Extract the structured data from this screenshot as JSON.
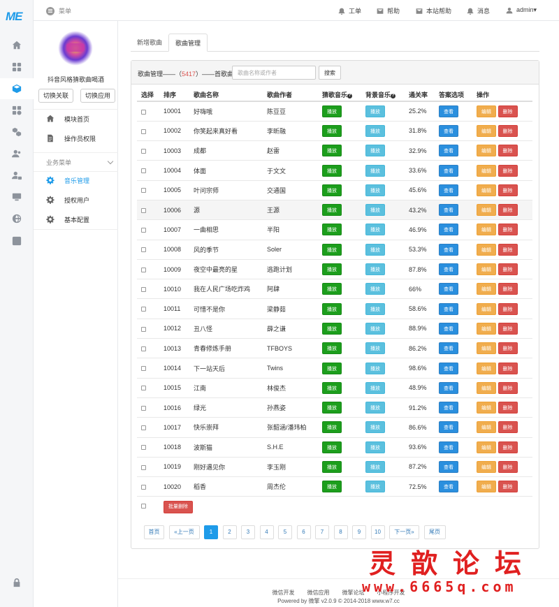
{
  "rail": {
    "logo": "ME",
    "icons": [
      "home-icon",
      "grid-icon",
      "box-icon",
      "apps-icon",
      "cubes-icon",
      "users-icon",
      "user-lock-icon",
      "monitor-icon",
      "globe-icon",
      "store-icon",
      "lock-icon"
    ]
  },
  "topbar": {
    "menu_label": "菜单",
    "items": [
      {
        "label": "工单",
        "icon": "bell-icon"
      },
      {
        "label": "帮助",
        "icon": "mail-icon"
      },
      {
        "label": "本站帮助",
        "icon": "mail-icon"
      },
      {
        "label": "消息",
        "icon": "bell-icon"
      },
      {
        "label": "admin▾",
        "icon": "user-icon"
      }
    ]
  },
  "sidebar": {
    "app_name": "抖音风格猜歌曲喝酒",
    "switch_link": "切换关联",
    "switch_app": "切换应用",
    "items_top": [
      {
        "label": "模块首页",
        "icon": "home-icon"
      },
      {
        "label": "操作员权限",
        "icon": "doc-icon"
      }
    ],
    "group_label": "业务菜单",
    "items_biz": [
      {
        "label": "音乐管理",
        "icon": "gear-icon",
        "active": true
      },
      {
        "label": "授权用户",
        "icon": "gear-icon"
      },
      {
        "label": "基本配置",
        "icon": "gear-icon"
      }
    ]
  },
  "tabs": [
    {
      "label": "新增歌曲",
      "active": false
    },
    {
      "label": "歌曲管理",
      "active": true
    }
  ],
  "panel": {
    "label_prefix": "歌曲管理——（",
    "count": "5417",
    "label_suffix": "）——首歌曲",
    "search_placeholder": "歌曲名称或作者",
    "search_button": "搜索"
  },
  "table": {
    "headers": {
      "select": "选择",
      "order": "排序",
      "name": "歌曲名称",
      "author": "歌曲作者",
      "guess": "猜歌音乐",
      "bg": "背景音乐",
      "rate": "通关率",
      "answer": "答案选项",
      "ops": "操作"
    },
    "buttons": {
      "play": "播放",
      "view": "查看",
      "edit": "编辑",
      "delete": "删除"
    },
    "rows": [
      {
        "id": "10001",
        "name": "好嗨哦",
        "author": "陈豆豆",
        "rate": "25.2%"
      },
      {
        "id": "10002",
        "name": "你笑起来真好看",
        "author": "李昕融",
        "rate": "31.8%"
      },
      {
        "id": "10003",
        "name": "成都",
        "author": "赵雷",
        "rate": "32.9%"
      },
      {
        "id": "10004",
        "name": "体面",
        "author": "于文文",
        "rate": "33.6%"
      },
      {
        "id": "10005",
        "name": "叶问宗师",
        "author": "交通国",
        "rate": "45.6%"
      },
      {
        "id": "10006",
        "name": "源",
        "author": "王源",
        "rate": "43.2%"
      },
      {
        "id": "10007",
        "name": "一曲相思",
        "author": "半阳",
        "rate": "46.9%"
      },
      {
        "id": "10008",
        "name": "风的季节",
        "author": "Soler",
        "rate": "53.3%"
      },
      {
        "id": "10009",
        "name": "夜空中最亮的星",
        "author": "逃跑计划",
        "rate": "87.8%"
      },
      {
        "id": "10010",
        "name": "我在人民广场吃炸鸡",
        "author": "阿肆",
        "rate": "66%"
      },
      {
        "id": "10011",
        "name": "可惜不是你",
        "author": "梁静茹",
        "rate": "58.6%"
      },
      {
        "id": "10012",
        "name": "丑八怪",
        "author": "薛之谦",
        "rate": "88.9%"
      },
      {
        "id": "10013",
        "name": "青春修炼手册",
        "author": "TFBOYS",
        "rate": "86.2%"
      },
      {
        "id": "10014",
        "name": "下一站天后",
        "author": "Twins",
        "rate": "98.6%"
      },
      {
        "id": "10015",
        "name": "江南",
        "author": "林俊杰",
        "rate": "48.9%"
      },
      {
        "id": "10016",
        "name": "绿光",
        "author": "孙燕姿",
        "rate": "91.2%"
      },
      {
        "id": "10017",
        "name": "快乐崇拜",
        "author": "张韶涵/潘玮柏",
        "rate": "86.6%"
      },
      {
        "id": "10018",
        "name": "波斯猫",
        "author": "S.H.E",
        "rate": "93.6%"
      },
      {
        "id": "10019",
        "name": "刚好遇见你",
        "author": "李玉刚",
        "rate": "87.2%"
      },
      {
        "id": "10020",
        "name": "稻香",
        "author": "周杰伦",
        "rate": "72.5%"
      }
    ],
    "batch_delete": "批量删除"
  },
  "pager": {
    "first": "首页",
    "prev": "«上一页",
    "pages": [
      "1",
      "2",
      "3",
      "4",
      "5",
      "6",
      "7",
      "8",
      "9",
      "10"
    ],
    "current": "1",
    "next": "下一页»",
    "last": "尾页"
  },
  "footer": {
    "links": [
      "微信开发",
      "微信应用",
      "微擎论坛",
      "小程序开发"
    ],
    "copyright": "Powered by 微擎 v2.0.9 © 2014-2018 www.w7.cc"
  },
  "watermark": {
    "title": "灵歆论坛",
    "url": "www.6665q.com"
  },
  "colors": {
    "accent": "#1e9be9",
    "play_green": "#1c9e1c",
    "play_cyan": "#5bc0de",
    "view_blue": "#2a8fde",
    "edit_orange": "#f0ad4e",
    "delete_red": "#d9534f"
  }
}
